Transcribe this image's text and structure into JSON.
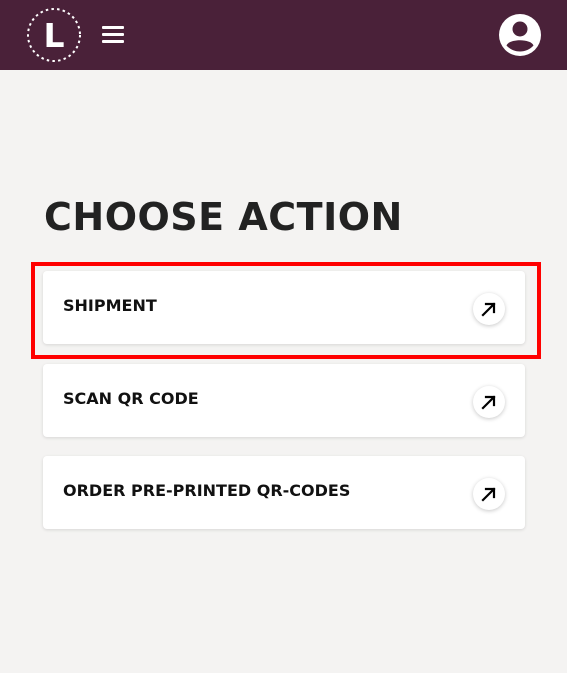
{
  "header": {
    "logo_letter": "L",
    "colors": {
      "bar": "#4a2139",
      "icon": "#ffffff"
    },
    "icons": [
      "logo-icon",
      "hamburger-menu-icon",
      "user-avatar-icon"
    ]
  },
  "main": {
    "title": "CHOOSE ACTION",
    "actions": [
      {
        "label": "SHIPMENT",
        "icon": "arrow-up-right-icon",
        "highlighted": true
      },
      {
        "label": "SCAN QR CODE",
        "icon": "arrow-up-right-icon",
        "highlighted": false
      },
      {
        "label": "ORDER PRE-PRINTED QR-CODES",
        "icon": "arrow-up-right-icon",
        "highlighted": false
      }
    ],
    "highlight_color": "#ff0000"
  }
}
